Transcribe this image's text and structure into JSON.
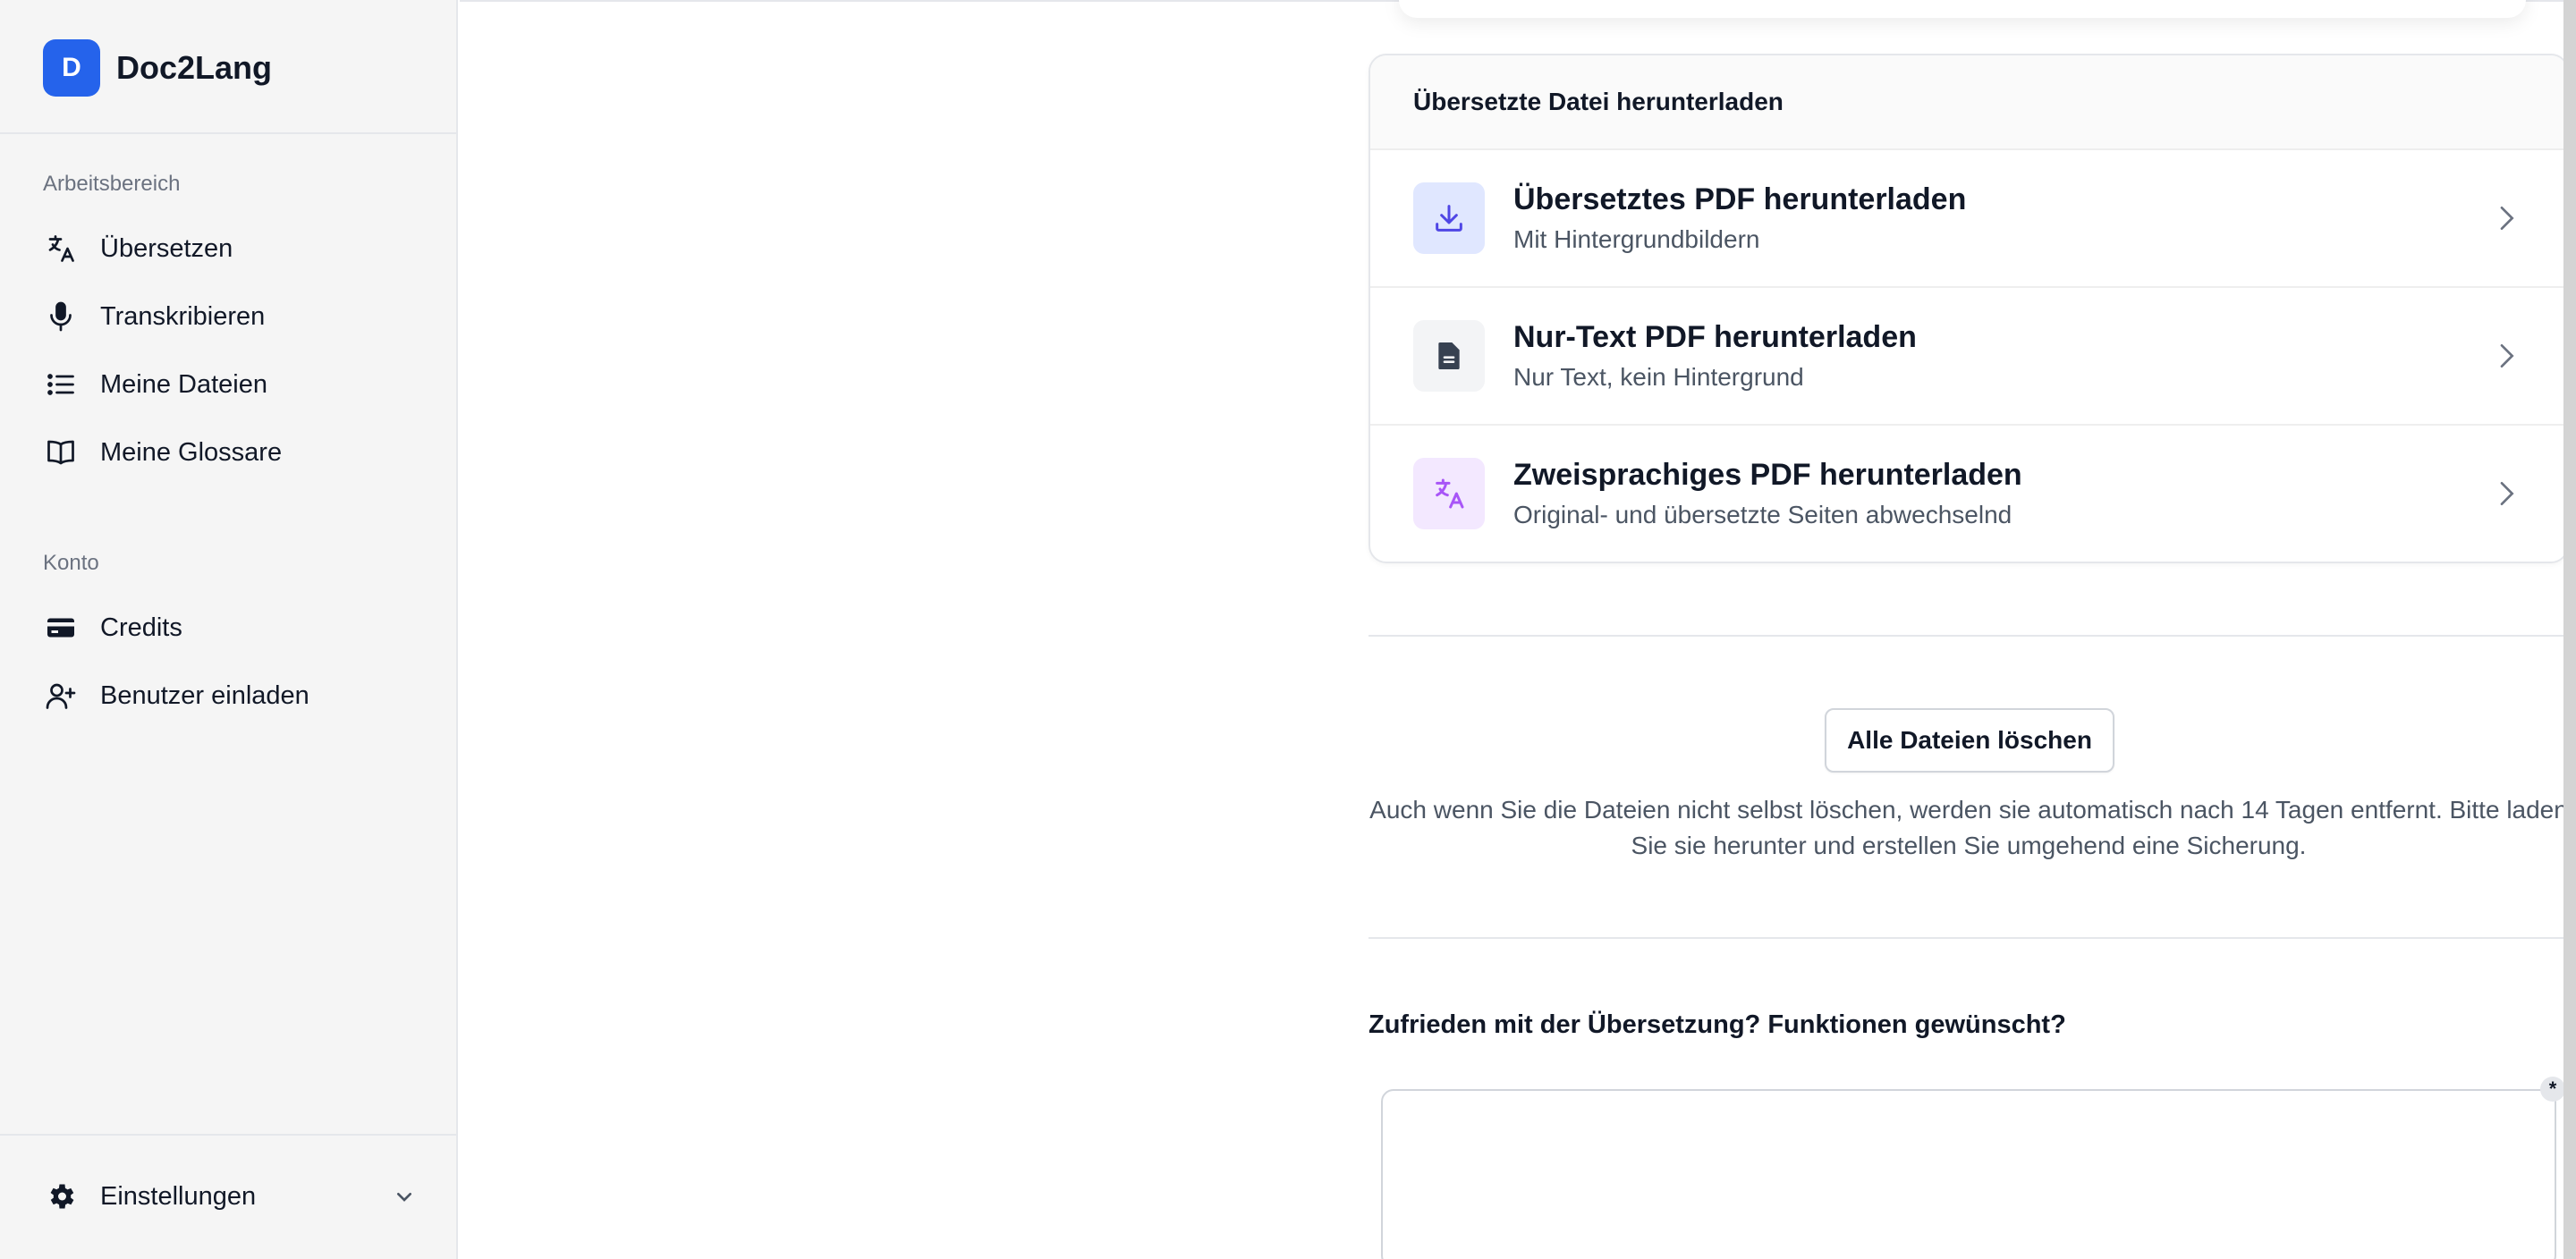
{
  "brand": {
    "logo_letter": "D",
    "name": "Doc2Lang"
  },
  "sidebar": {
    "workspace_label": "Arbeitsbereich",
    "workspace_items": [
      {
        "label": "Übersetzen",
        "icon": "translate-icon"
      },
      {
        "label": "Transkribieren",
        "icon": "microphone-icon"
      },
      {
        "label": "Meine Dateien",
        "icon": "list-icon"
      },
      {
        "label": "Meine Glossare",
        "icon": "book-icon"
      }
    ],
    "account_label": "Konto",
    "account_items": [
      {
        "label": "Credits",
        "icon": "credit-card-icon"
      },
      {
        "label": "Benutzer einladen",
        "icon": "user-plus-icon"
      }
    ],
    "settings_label": "Einstellungen"
  },
  "download_card": {
    "header": "Übersetzte Datei herunterladen",
    "items": [
      {
        "title": "Übersetztes PDF herunterladen",
        "subtitle": "Mit Hintergrundbildern",
        "icon": "download-icon",
        "color": "#4f46e5",
        "bg": "#e0e7ff"
      },
      {
        "title": "Nur-Text PDF herunterladen",
        "subtitle": "Nur Text, kein Hintergrund",
        "icon": "document-icon",
        "color": "#374151",
        "bg": "#f3f4f6"
      },
      {
        "title": "Zweisprachiges PDF herunterladen",
        "subtitle": "Original- und übersetzte Seiten abwechselnd",
        "icon": "translate-icon",
        "color": "#a855f7",
        "bg": "#f3e8ff"
      }
    ]
  },
  "delete_button_label": "Alle Dateien löschen",
  "notice": "Auch wenn Sie die Dateien nicht selbst löschen, werden sie automatisch nach 14 Tagen entfernt. Bitte laden Sie sie herunter und erstellen Sie umgehend eine Sicherung.",
  "feedback": {
    "label": "Zufrieden mit der Übersetzung? Funktionen gewünscht?",
    "placeholder": "",
    "required_marker": "*"
  },
  "colors": {
    "accent": "#2563eb",
    "sidebar_bg": "#f5f5f5"
  }
}
